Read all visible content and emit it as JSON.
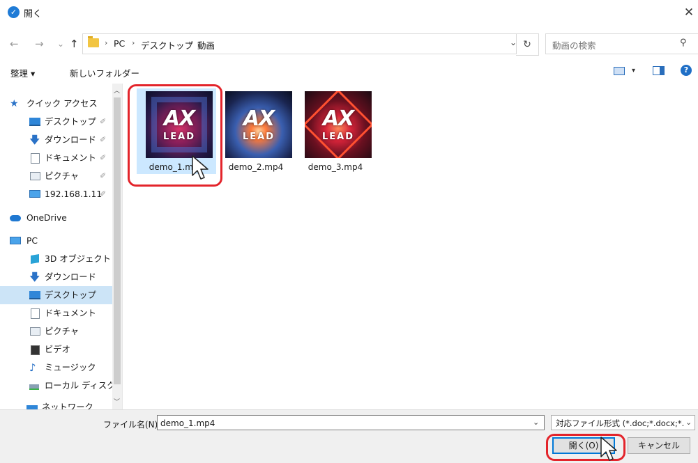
{
  "window": {
    "title": "開く",
    "close_label": "✕"
  },
  "nav": {
    "back": "←",
    "forward": "→",
    "recent": "⌄",
    "up": "↑",
    "breadcrumb": [
      "PC",
      "デスクトップ",
      "動画"
    ],
    "separator": "›",
    "refresh": "↻",
    "search_placeholder": "動画の検索"
  },
  "toolbar": {
    "organize_label": "整理 ▾",
    "new_folder_label": "新しいフォルダー",
    "help": "?"
  },
  "sidebar": {
    "items": [
      {
        "label": "クイック アクセス",
        "icon": "star-icon"
      },
      {
        "label": "デスクトップ",
        "icon": "desktop-icon",
        "pinned": true
      },
      {
        "label": "ダウンロード",
        "icon": "download-icon",
        "pinned": true
      },
      {
        "label": "ドキュメント",
        "icon": "document-icon",
        "pinned": true
      },
      {
        "label": "ピクチャ",
        "icon": "pictures-icon",
        "pinned": true
      },
      {
        "label": "192.168.1.11",
        "icon": "network-drive-icon",
        "pinned": true
      },
      {
        "label": "OneDrive",
        "icon": "cloud-icon"
      },
      {
        "label": "PC",
        "icon": "pc-icon"
      },
      {
        "label": "3D オブジェクト",
        "icon": "3d-objects-icon"
      },
      {
        "label": "ダウンロード",
        "icon": "download-icon"
      },
      {
        "label": "デスクトップ",
        "icon": "desktop-icon",
        "selected": true
      },
      {
        "label": "ドキュメント",
        "icon": "document-icon"
      },
      {
        "label": "ピクチャ",
        "icon": "pictures-icon"
      },
      {
        "label": "ビデオ",
        "icon": "video-icon"
      },
      {
        "label": "ミュージック",
        "icon": "music-icon"
      },
      {
        "label": "ローカル ディスク (C",
        "icon": "local-disk-icon"
      },
      {
        "label": "ネットワーク",
        "icon": "network-icon"
      }
    ],
    "pin_glyph": "📌"
  },
  "files": [
    {
      "name": "demo_1.mp4",
      "selected": true,
      "logo_text": "AX",
      "logo_sub": "LEAD"
    },
    {
      "name": "demo_2.mp4",
      "selected": false,
      "logo_text": "AX",
      "logo_sub": "LEAD"
    },
    {
      "name": "demo_3.mp4",
      "selected": false,
      "logo_text": "AX",
      "logo_sub": "LEAD"
    }
  ],
  "footer": {
    "filename_label": "ファイル名(N):",
    "filename_value": "demo_1.mp4",
    "filter_value": "対応ファイル形式 (*.doc;*.docx;*.",
    "open_label": "開く(O)",
    "cancel_label": "キャンセル"
  },
  "colors": {
    "accent": "#0078d7",
    "highlight": "#e3242b",
    "selection": "#cce8ff"
  }
}
